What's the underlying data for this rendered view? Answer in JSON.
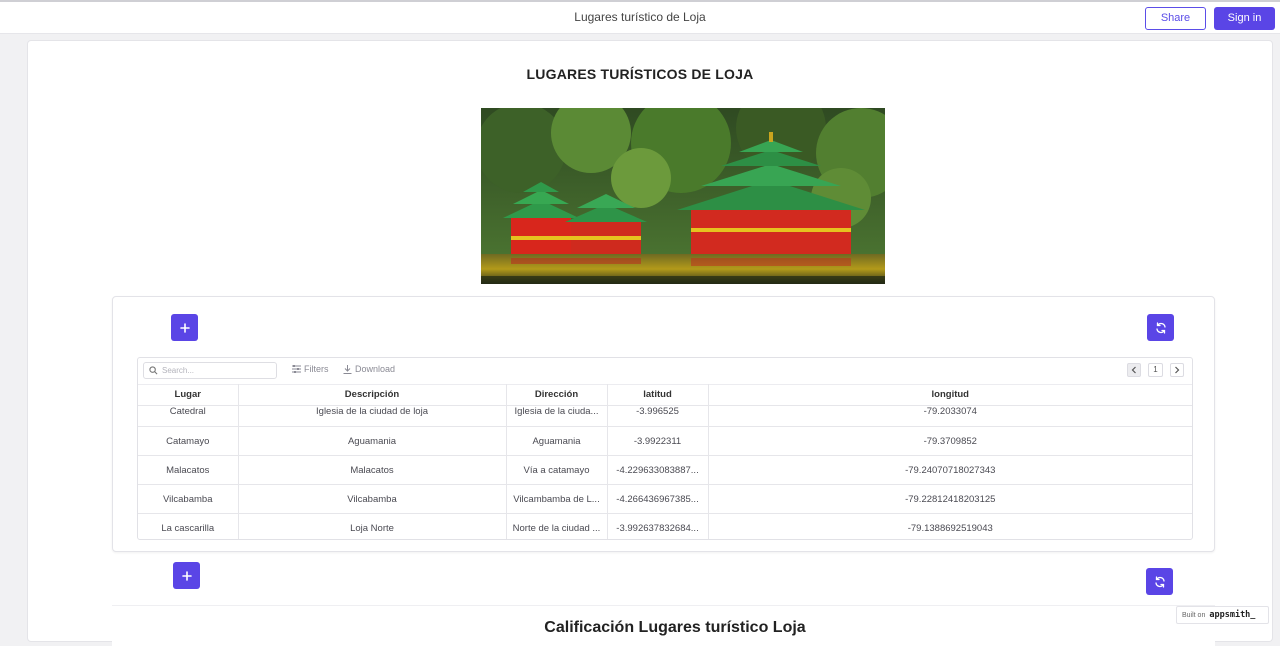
{
  "app": {
    "title": "Lugares turístico de Loja",
    "share_label": "Share",
    "signin_label": "Sign in",
    "accent_color": "#5a45e6"
  },
  "page": {
    "heading": "LUGARES TURÍSTICOS DE LOJA"
  },
  "table": {
    "search_placeholder": "Search...",
    "filters_label": "Filters",
    "download_label": "Download",
    "page_number": "1",
    "columns": [
      "Lugar",
      "Descripción",
      "Dirección",
      "latitud",
      "longitud"
    ],
    "rows": [
      [
        "Catedral",
        "Iglesia de la ciudad de loja",
        "Iglesia de la ciuda...",
        "-3.996525",
        "-79.2033074"
      ],
      [
        "Catamayo",
        "Aguamania",
        "Aguamania",
        "-3.9922311",
        "-79.3709852"
      ],
      [
        "Malacatos",
        "Malacatos",
        "Vía a catamayo",
        "-4.229633083887...",
        "-79.24070718027343"
      ],
      [
        "Vilcabamba",
        "Vilcabamba",
        "Vilcambamba de L...",
        "-4.266436967385...",
        "-79.22812418203125"
      ],
      [
        "La cascarilla",
        "Loja Norte",
        "Norte de la ciudad ...",
        "-3.992637832684...",
        "-79.1388692519043"
      ]
    ]
  },
  "section2": {
    "title": "Calificación Lugares turístico Loja"
  },
  "footer": {
    "built_on": "Built on",
    "brand": "appsmith_"
  }
}
